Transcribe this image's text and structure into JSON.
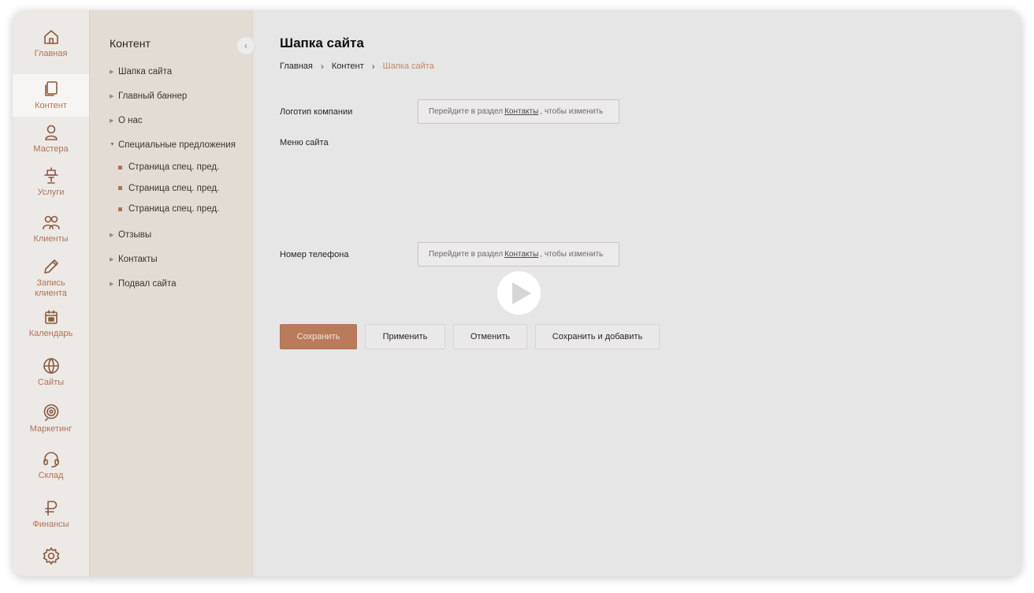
{
  "nav": {
    "items": [
      {
        "label": "Главная",
        "icon": "home-icon"
      },
      {
        "label": "Контент",
        "icon": "pages-icon",
        "active": true
      },
      {
        "label": "Мастера",
        "icon": "person-icon"
      },
      {
        "label": "Услуги",
        "icon": "chair-icon"
      },
      {
        "label": "Клиенты",
        "icon": "people-icon"
      },
      {
        "label": "Запись клиента",
        "icon": "pencil-icon"
      },
      {
        "label": "Календарь",
        "icon": "calendar-icon"
      },
      {
        "label": "Сайты",
        "icon": "globe-icon"
      },
      {
        "label": "Маркетинг",
        "icon": "target-icon"
      },
      {
        "label": "Склад",
        "icon": "headset-icon"
      },
      {
        "label": "Финансы",
        "icon": "ruble-icon"
      },
      {
        "label": "",
        "icon": "gear-icon"
      }
    ]
  },
  "tree": {
    "title": "Контент",
    "collapse_glyph": "‹",
    "items": [
      {
        "label": "Шапка сайта"
      },
      {
        "label": "Главный баннер"
      },
      {
        "label": "О нас"
      },
      {
        "label": "Специальные предложения",
        "open": true,
        "children": [
          "Страница спец. пред.",
          "Страница спец. пред.",
          "Страница спец. пред."
        ]
      },
      {
        "label": "Отзывы"
      },
      {
        "label": "Контакты"
      },
      {
        "label": "Подвал сайта"
      }
    ]
  },
  "main": {
    "title": "Шапка сайта",
    "breadcrumb": [
      "Главная",
      "Контент",
      "Шапка сайта"
    ],
    "breadcrumb_sep": "›",
    "logo": {
      "label": "Логотип компании",
      "hint_before": "Перейдите в раздел",
      "hint_link": "Контакты",
      "hint_after": ", чтобы изменить"
    },
    "menu_label": "Меню сайта",
    "phone": {
      "label": "Номер телефона",
      "hint_before": "Перейдите в раздел",
      "hint_link": "Контакты",
      "hint_after": ", чтобы изменить"
    },
    "buttons": {
      "save": "Сохранить",
      "apply": "Применить",
      "cancel": "Отменить",
      "save_add": "Сохранить и добавить"
    }
  },
  "colors": {
    "accent": "#b97b5a",
    "accent_text": "#b07354",
    "breadcrumb_current": "#c08a6d",
    "tree_bg": "#e3dcd5",
    "main_bg": "#e6e6e6"
  }
}
